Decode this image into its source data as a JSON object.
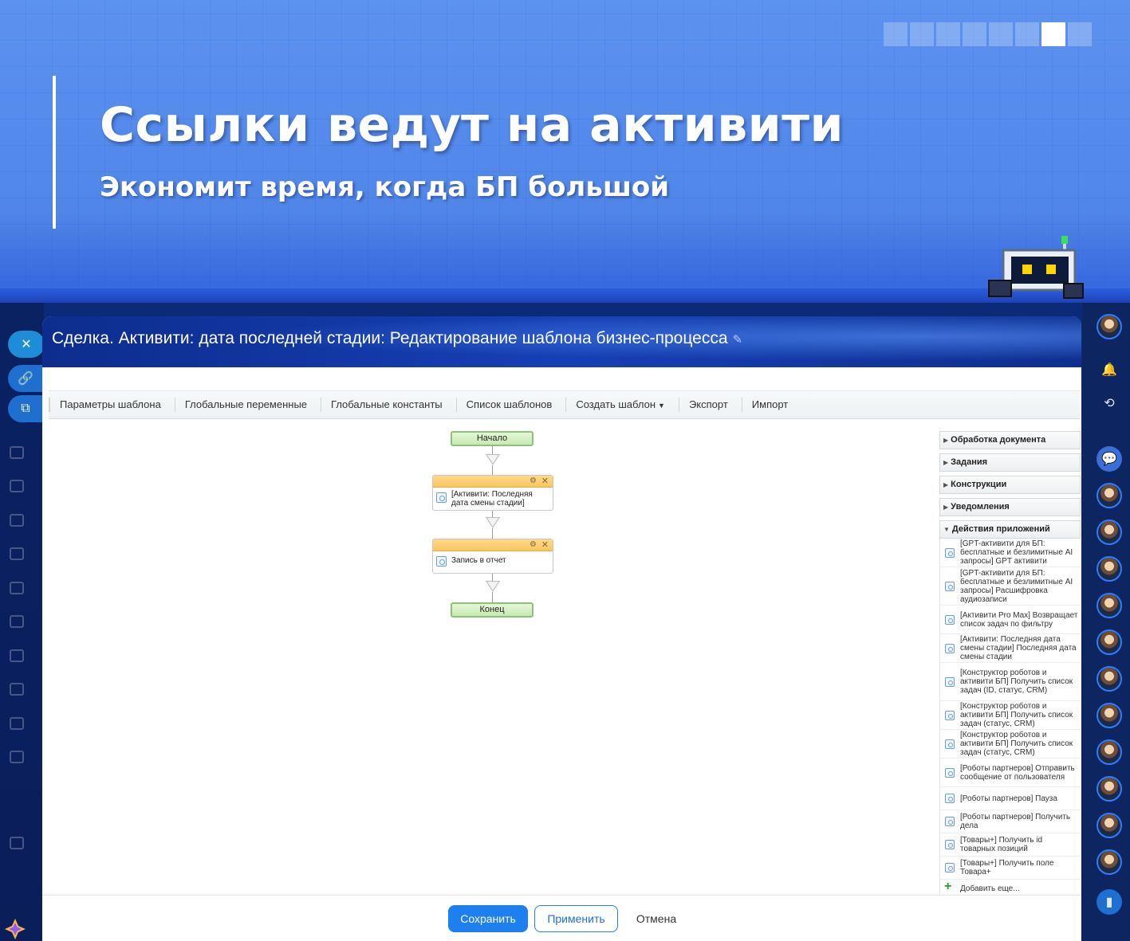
{
  "banner": {
    "title": "Ссылки ведут на активити",
    "subtitle": "Экономит время, когда БП большой",
    "pager": {
      "count": 8,
      "active_index": 6
    }
  },
  "slider": {
    "title": "Сделка. Активити: дата последней стадии: Редактирование шаблона бизнес-процесса"
  },
  "toolbar": {
    "items": [
      {
        "label": "Параметры шаблона"
      },
      {
        "label": "Глобальные переменные"
      },
      {
        "label": "Глобальные константы"
      },
      {
        "label": "Список шаблонов"
      },
      {
        "label": "Создать шаблон",
        "dropdown": true
      },
      {
        "label": "Экспорт"
      },
      {
        "label": "Импорт"
      }
    ]
  },
  "workflow": {
    "start_label": "Начало",
    "end_label": "Конец",
    "blocks": [
      {
        "text": "[Активити: Последняя дата смены стадии]"
      },
      {
        "text": "Запись в отчет"
      }
    ]
  },
  "panel": {
    "groups": [
      {
        "label": "Обработка документа",
        "expanded": false
      },
      {
        "label": "Задания",
        "expanded": false
      },
      {
        "label": "Конструкции",
        "expanded": false
      },
      {
        "label": "Уведомления",
        "expanded": false
      },
      {
        "label": "Действия приложений",
        "expanded": true
      }
    ],
    "items": [
      "[GPT-активити для БП: бесплатные и безлимитные AI запросы] GPT активити",
      "[GPT-активити для БП: бесплатные и безлимитные AI запросы] Расшифровка аудиозаписи",
      "[Активити Pro Max] Возвращает список задач по фильтру",
      "[Активити: Последняя дата смены стадии] Последняя дата смены стадии",
      "[Конструктор роботов и активити БП] Получить список задач (ID, статус, CRM)",
      "[Конструктор роботов и активити БП] Получить список задач (статус, CRM)",
      "[Конструктор роботов и активити БП] Получить список задач (статус, CRM)",
      "[Роботы партнеров] Отправить сообщение от пользователя",
      "[Роботы партнеров] Пауза",
      "[Роботы партнеров] Получить дела",
      "[Товары+] Получить id товарных позиций",
      "[Товары+] Получить поле Товара+"
    ],
    "add_more": "Добавить еще..."
  },
  "footer": {
    "save": "Сохранить",
    "apply": "Применить",
    "cancel": "Отмена"
  },
  "colors": {
    "accent": "#1e7fee",
    "block_header": "#f8c65e",
    "start_end_fill": "#c6eab0"
  },
  "icons": {
    "close": "close-icon",
    "link": "link-icon",
    "open_new": "open-in-new-icon",
    "pin": "pin-icon",
    "gear": "gear-icon",
    "activity": "activity-icon"
  }
}
